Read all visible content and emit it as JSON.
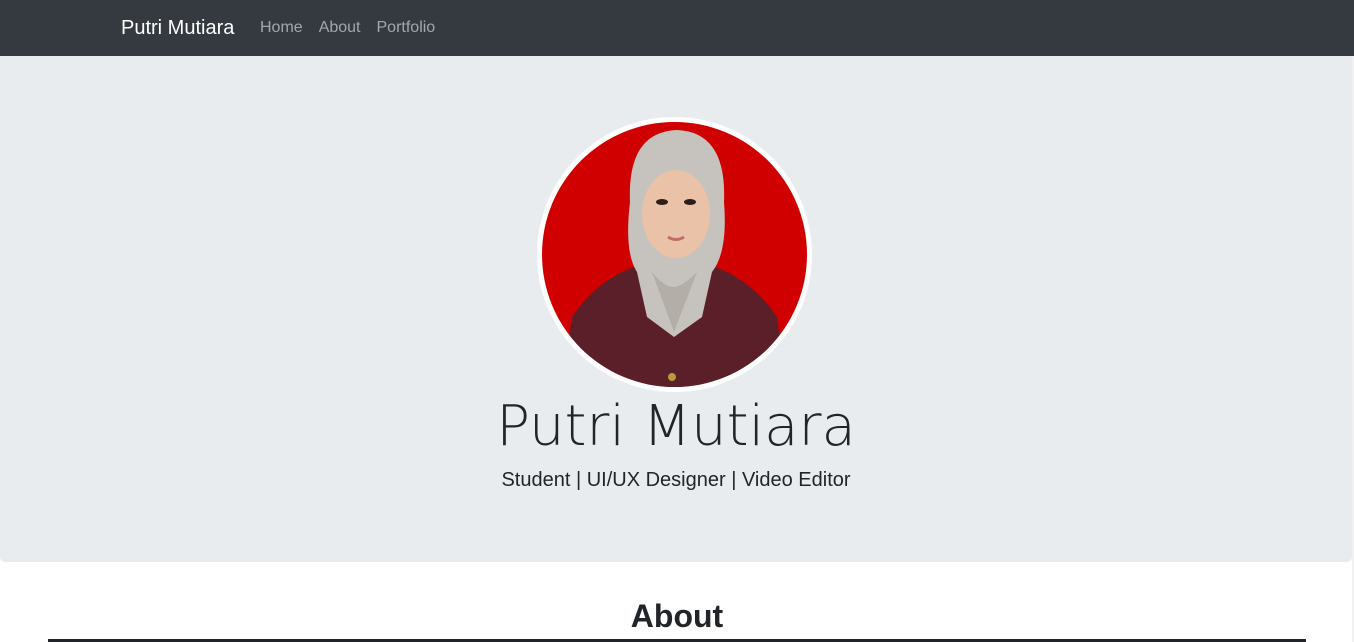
{
  "navbar": {
    "brand": "Putri Mutiara",
    "links": [
      {
        "label": "Home"
      },
      {
        "label": "About"
      },
      {
        "label": "Portfolio"
      }
    ]
  },
  "hero": {
    "name": "Putri Mutiara",
    "tagline": "Student | UI/UX Designer | Video Editor",
    "avatar_alt": "profile photo"
  },
  "about": {
    "heading": "About"
  },
  "colors": {
    "navbar_bg": "#343a40",
    "hero_bg": "#e9ecef",
    "photo_bg": "#d10000"
  }
}
